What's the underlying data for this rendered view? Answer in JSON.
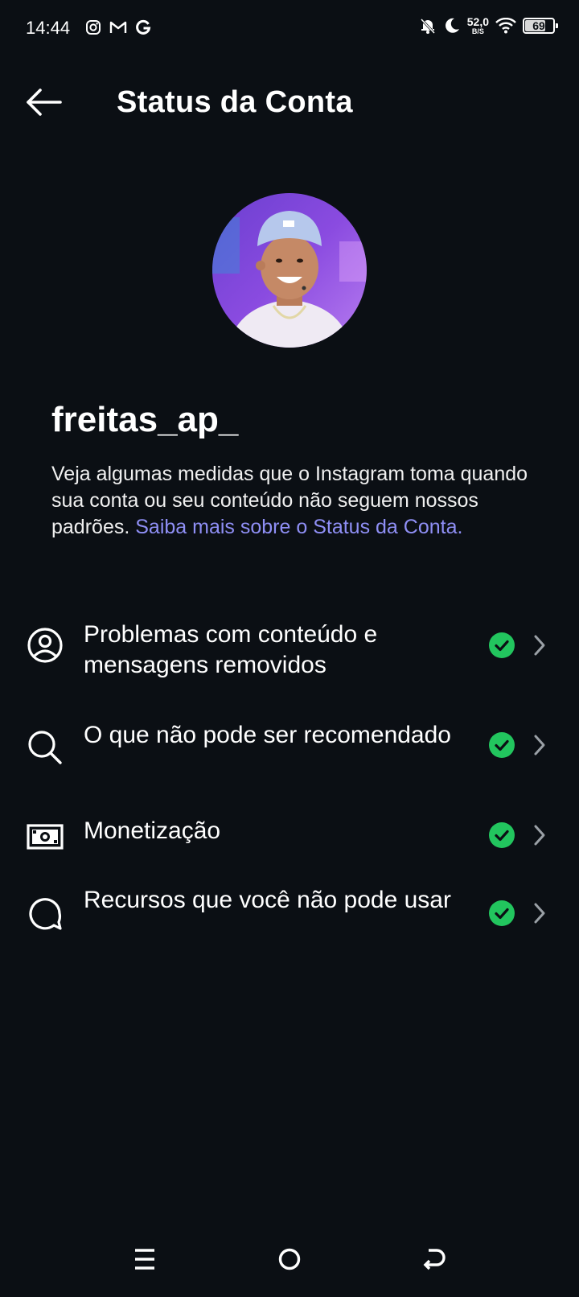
{
  "status_bar": {
    "time": "14:44",
    "net_speed_value": "52,0",
    "net_speed_unit": "B/S",
    "battery_level": "69",
    "app_icons": [
      "instagram-icon",
      "gmail-icon",
      "google-icon"
    ],
    "system_icons": [
      "bell-off-icon",
      "moon-icon",
      "wifi-icon",
      "battery-icon"
    ]
  },
  "header": {
    "title": "Status da Conta"
  },
  "profile": {
    "username": "freitas_ap_",
    "description": "Veja algumas medidas que o Instagram toma quando sua conta ou seu conteúdo não seguem nossos padrões. ",
    "link_text": "Saiba mais sobre o Status da Conta."
  },
  "items": [
    {
      "label": "Problemas com conteúdo e mensagens removidos",
      "icon": "user-circle-icon",
      "status": "ok"
    },
    {
      "label": "O que não pode ser recomendado",
      "icon": "search-icon",
      "status": "ok"
    },
    {
      "label": "Monetização",
      "icon": "money-icon",
      "status": "ok"
    },
    {
      "label": "Recursos que você não pode usar",
      "icon": "chat-bubble-icon",
      "status": "ok"
    }
  ],
  "colors": {
    "background": "#0b0f14",
    "link": "#8f8ff5",
    "status_ok": "#22c55e"
  }
}
